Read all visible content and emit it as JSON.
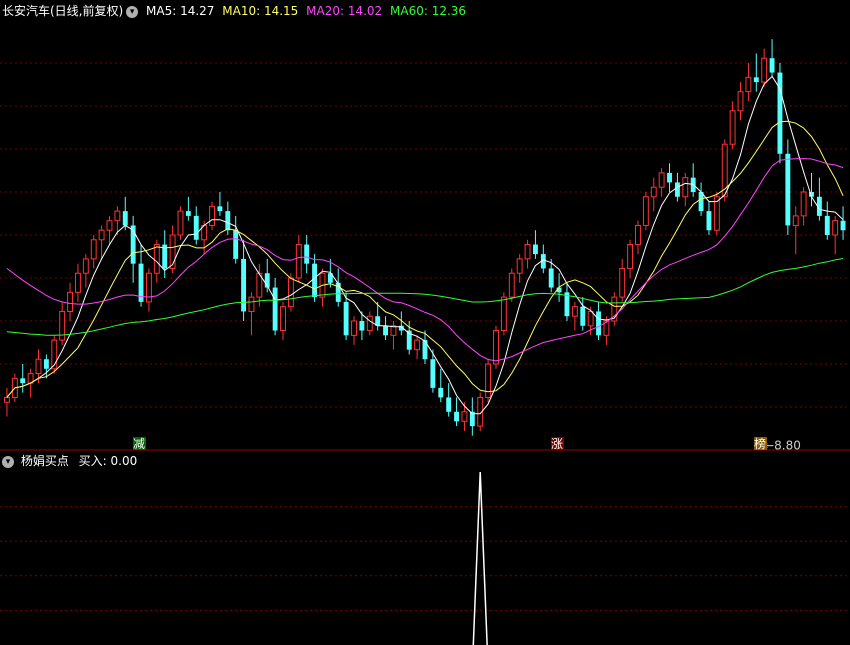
{
  "header": {
    "stock_title": "长安汽车(日线,前复权)",
    "ma5_label": "MA5: 14.27",
    "ma10_label": "MA10: 14.15",
    "ma20_label": "MA20: 14.02",
    "ma60_label": "MA60: 12.36",
    "ma5_color": "#ffffff",
    "ma10_color": "#ffff66",
    "ma20_color": "#ff44ff",
    "ma60_color": "#33ff33",
    "dropdown_icon": "chevron-down-icon"
  },
  "indicator": {
    "title": "杨娟买点",
    "value_label": "买入: 0.00"
  },
  "annotations": {
    "low_price": "←8.80",
    "event_1": "减",
    "event_2": "涨",
    "event_3": "榜"
  },
  "colors": {
    "up": "#ff3333",
    "down": "#54ffff",
    "grid": "#7a0000",
    "axis": "#9a0000",
    "signal": "#ffffff"
  },
  "chart_data": [
    {
      "type": "candlestick",
      "title": "长安汽车(日线,前复权)",
      "ylim": [
        8.5,
        17.5
      ],
      "low_annotation": {
        "index": 97,
        "value": 8.8
      },
      "series": [
        {
          "name": "MA5",
          "value": 14.27
        },
        {
          "name": "MA10",
          "value": 14.15
        },
        {
          "name": "MA20",
          "value": 14.02
        },
        {
          "name": "MA60",
          "value": 12.36
        }
      ],
      "ohlc": [
        [
          9.5,
          9.8,
          9.2,
          9.6
        ],
        [
          9.6,
          10.1,
          9.5,
          10.0
        ],
        [
          10.0,
          10.3,
          9.7,
          9.9
        ],
        [
          9.9,
          10.2,
          9.6,
          10.1
        ],
        [
          10.1,
          10.6,
          9.9,
          10.4
        ],
        [
          10.4,
          10.5,
          10.0,
          10.2
        ],
        [
          10.2,
          10.9,
          10.1,
          10.8
        ],
        [
          10.8,
          11.6,
          10.7,
          11.4
        ],
        [
          11.4,
          12.0,
          11.2,
          11.8
        ],
        [
          11.8,
          12.4,
          11.6,
          12.2
        ],
        [
          12.2,
          12.6,
          11.9,
          12.5
        ],
        [
          12.5,
          13.0,
          12.3,
          12.9
        ],
        [
          12.9,
          13.2,
          12.5,
          13.1
        ],
        [
          13.1,
          13.4,
          12.8,
          13.3
        ],
        [
          13.3,
          13.6,
          13.0,
          13.5
        ],
        [
          13.5,
          13.8,
          13.1,
          13.2
        ],
        [
          13.2,
          13.4,
          12.0,
          12.4
        ],
        [
          12.4,
          12.8,
          11.5,
          11.6
        ],
        [
          11.6,
          12.3,
          11.4,
          12.2
        ],
        [
          12.2,
          12.9,
          12.0,
          12.8
        ],
        [
          12.8,
          13.1,
          12.1,
          12.3
        ],
        [
          12.3,
          13.2,
          12.2,
          13.0
        ],
        [
          13.0,
          13.6,
          12.9,
          13.5
        ],
        [
          13.5,
          13.8,
          13.3,
          13.4
        ],
        [
          13.4,
          13.6,
          12.8,
          12.9
        ],
        [
          12.9,
          13.3,
          12.6,
          13.2
        ],
        [
          13.2,
          13.7,
          13.1,
          13.6
        ],
        [
          13.6,
          13.9,
          13.4,
          13.5
        ],
        [
          13.5,
          13.7,
          13.0,
          13.1
        ],
        [
          13.1,
          13.4,
          12.4,
          12.5
        ],
        [
          12.5,
          12.9,
          11.2,
          11.4
        ],
        [
          11.4,
          11.8,
          10.9,
          11.7
        ],
        [
          11.7,
          12.4,
          11.5,
          12.2
        ],
        [
          12.2,
          12.5,
          11.8,
          11.9
        ],
        [
          11.9,
          12.1,
          10.9,
          11.0
        ],
        [
          11.0,
          11.6,
          10.8,
          11.5
        ],
        [
          11.5,
          12.2,
          11.4,
          12.1
        ],
        [
          12.1,
          13.0,
          12.0,
          12.8
        ],
        [
          12.8,
          13.0,
          12.2,
          12.4
        ],
        [
          12.4,
          12.6,
          11.6,
          11.7
        ],
        [
          11.7,
          12.3,
          11.5,
          12.2
        ],
        [
          12.2,
          12.5,
          11.9,
          12.0
        ],
        [
          12.0,
          12.3,
          11.5,
          11.6
        ],
        [
          11.6,
          11.8,
          10.8,
          10.9
        ],
        [
          10.9,
          11.3,
          10.7,
          11.2
        ],
        [
          11.2,
          11.4,
          10.8,
          11.0
        ],
        [
          11.0,
          11.4,
          10.9,
          11.3
        ],
        [
          11.3,
          11.6,
          11.0,
          11.1
        ],
        [
          11.1,
          11.3,
          10.8,
          10.9
        ],
        [
          10.9,
          11.2,
          10.6,
          11.1
        ],
        [
          11.1,
          11.4,
          10.9,
          11.0
        ],
        [
          11.0,
          11.2,
          10.5,
          10.6
        ],
        [
          10.6,
          10.9,
          10.4,
          10.8
        ],
        [
          10.8,
          11.0,
          10.3,
          10.4
        ],
        [
          10.4,
          10.6,
          9.7,
          9.8
        ],
        [
          9.8,
          10.2,
          9.5,
          9.6
        ],
        [
          9.6,
          9.9,
          9.2,
          9.3
        ],
        [
          9.3,
          9.6,
          9.0,
          9.1
        ],
        [
          9.1,
          9.5,
          8.9,
          9.3
        ],
        [
          9.3,
          9.6,
          8.8,
          9.0
        ],
        [
          9.0,
          9.7,
          8.9,
          9.6
        ],
        [
          9.6,
          10.4,
          9.5,
          10.3
        ],
        [
          10.3,
          11.1,
          10.2,
          11.0
        ],
        [
          11.0,
          11.8,
          10.9,
          11.7
        ],
        [
          11.7,
          12.3,
          11.6,
          12.2
        ],
        [
          12.2,
          12.6,
          12.0,
          12.5
        ],
        [
          12.5,
          12.9,
          12.3,
          12.8
        ],
        [
          12.8,
          13.1,
          12.5,
          12.6
        ],
        [
          12.6,
          12.8,
          12.2,
          12.3
        ],
        [
          12.3,
          12.5,
          11.8,
          11.9
        ],
        [
          11.9,
          12.2,
          11.6,
          11.8
        ],
        [
          11.8,
          12.0,
          11.2,
          11.3
        ],
        [
          11.3,
          11.6,
          11.0,
          11.5
        ],
        [
          11.5,
          11.7,
          11.0,
          11.1
        ],
        [
          11.1,
          11.5,
          10.9,
          11.4
        ],
        [
          11.4,
          11.6,
          10.8,
          10.9
        ],
        [
          10.9,
          11.3,
          10.7,
          11.2
        ],
        [
          11.2,
          11.8,
          11.1,
          11.7
        ],
        [
          11.7,
          12.5,
          11.6,
          12.3
        ],
        [
          12.3,
          12.9,
          12.1,
          12.8
        ],
        [
          12.8,
          13.3,
          12.6,
          13.2
        ],
        [
          13.2,
          13.9,
          13.1,
          13.8
        ],
        [
          13.8,
          14.2,
          13.5,
          14.0
        ],
        [
          14.0,
          14.4,
          13.8,
          14.3
        ],
        [
          14.3,
          14.5,
          13.9,
          14.1
        ],
        [
          14.1,
          14.3,
          13.7,
          13.8
        ],
        [
          13.8,
          14.3,
          13.6,
          14.2
        ],
        [
          14.2,
          14.5,
          13.8,
          13.9
        ],
        [
          13.9,
          14.1,
          13.4,
          13.5
        ],
        [
          13.5,
          13.7,
          13.0,
          13.1
        ],
        [
          13.1,
          13.9,
          13.0,
          13.8
        ],
        [
          13.8,
          15.0,
          13.7,
          14.9
        ],
        [
          14.9,
          15.8,
          14.8,
          15.6
        ],
        [
          15.6,
          16.2,
          15.4,
          16.0
        ],
        [
          16.0,
          16.6,
          15.8,
          16.3
        ],
        [
          16.3,
          16.8,
          16.0,
          16.2
        ],
        [
          16.2,
          16.9,
          16.1,
          16.7
        ],
        [
          16.7,
          17.1,
          16.3,
          16.4
        ],
        [
          16.4,
          16.6,
          14.5,
          14.7
        ],
        [
          14.7,
          15.0,
          13.0,
          13.2
        ],
        [
          13.2,
          13.6,
          12.6,
          13.4
        ],
        [
          13.4,
          14.0,
          13.2,
          13.9
        ],
        [
          13.9,
          14.3,
          13.6,
          13.8
        ],
        [
          13.8,
          14.2,
          13.3,
          13.4
        ],
        [
          13.4,
          13.7,
          12.9,
          13.0
        ],
        [
          13.0,
          13.4,
          12.6,
          13.3
        ],
        [
          13.3,
          13.6,
          12.9,
          13.1
        ]
      ]
    },
    {
      "type": "line",
      "title": "杨娟买点",
      "series": [
        {
          "name": "买入",
          "value": 0.0
        }
      ],
      "signal_index": 60,
      "signal_value": 1.0,
      "ylim": [
        0,
        1
      ]
    }
  ]
}
